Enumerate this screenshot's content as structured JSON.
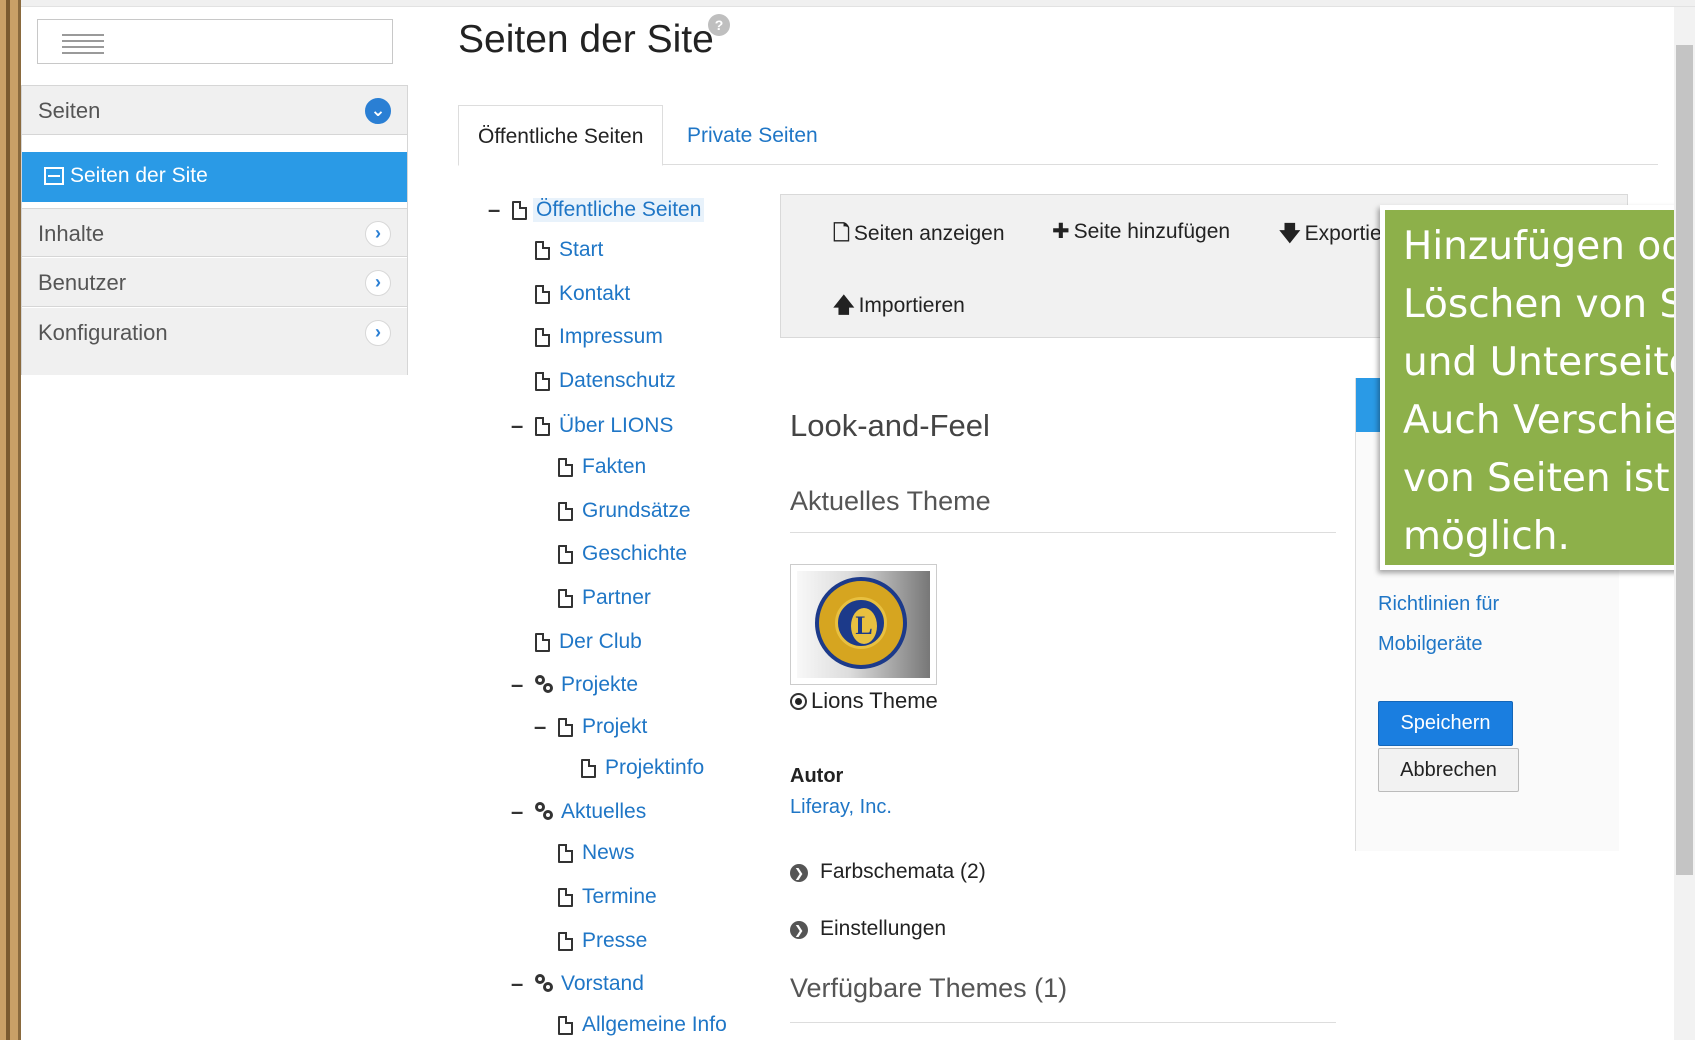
{
  "sidebar": {
    "sections": [
      {
        "label": "Seiten",
        "state": "expanded"
      },
      {
        "label": "Inhalte",
        "state": "collapsed"
      },
      {
        "label": "Benutzer",
        "state": "collapsed"
      },
      {
        "label": "Konfiguration",
        "state": "collapsed"
      }
    ],
    "active_item": "Seiten der Site"
  },
  "page": {
    "title": "Seiten der Site",
    "help_glyph": "?"
  },
  "tabs": [
    {
      "label": "Öffentliche Seiten",
      "active": true
    },
    {
      "label": "Private Seiten",
      "active": false
    }
  ],
  "tree": [
    {
      "label": "Öffentliche Seiten",
      "toggle": "–",
      "icon": "page-icon",
      "selected": true
    },
    {
      "label": "Start",
      "toggle": "",
      "icon": "page-icon"
    },
    {
      "label": "Kontakt",
      "toggle": "",
      "icon": "page-icon"
    },
    {
      "label": "Impressum",
      "toggle": "",
      "icon": "page-icon"
    },
    {
      "label": "Datenschutz",
      "toggle": "",
      "icon": "page-icon"
    },
    {
      "label": "Über LIONS",
      "toggle": "–",
      "icon": "page-icon"
    },
    {
      "label": "Fakten",
      "toggle": "",
      "icon": "page-icon"
    },
    {
      "label": "Grundsätze",
      "toggle": "",
      "icon": "page-icon"
    },
    {
      "label": "Geschichte",
      "toggle": "",
      "icon": "page-icon"
    },
    {
      "label": "Partner",
      "toggle": "",
      "icon": "page-icon"
    },
    {
      "label": "Der Club",
      "toggle": "",
      "icon": "page-icon"
    },
    {
      "label": "Projekte",
      "toggle": "–",
      "icon": "link-icon"
    },
    {
      "label": "Projekt",
      "toggle": "–",
      "icon": "page-icon"
    },
    {
      "label": "Projektinfo",
      "toggle": "",
      "icon": "page-icon"
    },
    {
      "label": "Aktuelles",
      "toggle": "–",
      "icon": "link-icon"
    },
    {
      "label": "News",
      "toggle": "",
      "icon": "page-icon"
    },
    {
      "label": "Termine",
      "toggle": "",
      "icon": "page-icon"
    },
    {
      "label": "Presse",
      "toggle": "",
      "icon": "page-icon"
    },
    {
      "label": "Vorstand",
      "toggle": "–",
      "icon": "link-icon"
    },
    {
      "label": "Allgemeine Info",
      "toggle": "",
      "icon": "page-icon"
    }
  ],
  "toolbar": {
    "view_pages": "Seiten anzeigen",
    "add_page": "Seite hinzufügen",
    "export": "Exportie",
    "import": "Importieren"
  },
  "look_and_feel": {
    "heading": "Look-and-Feel",
    "current_theme_heading": "Aktuelles Theme",
    "theme_name": "Lions Theme",
    "author_label": "Autor",
    "author_value": "Liferay, Inc.",
    "color_schemes": "Farbschemata (2)",
    "settings": "Einstellungen",
    "available_themes": "Verfügbare Themes (1)",
    "logo_letter": "L"
  },
  "right_panel": {
    "link_line1": "Richtlinien für",
    "link_line2": "Mobilgeräte",
    "save_label": "Speichern",
    "cancel_label": "Abbrechen"
  },
  "tooltip": {
    "lines": [
      "Hinzufügen ode",
      "Löschen von Se",
      "und Unterseite",
      "Auch Verschieb",
      "von Seiten ist",
      "möglich."
    ]
  },
  "colors": {
    "accent": "#2a9ae6",
    "link": "#1f76c6",
    "tooltip_bg": "#8db04a",
    "button_primary": "#1a7ee0"
  }
}
